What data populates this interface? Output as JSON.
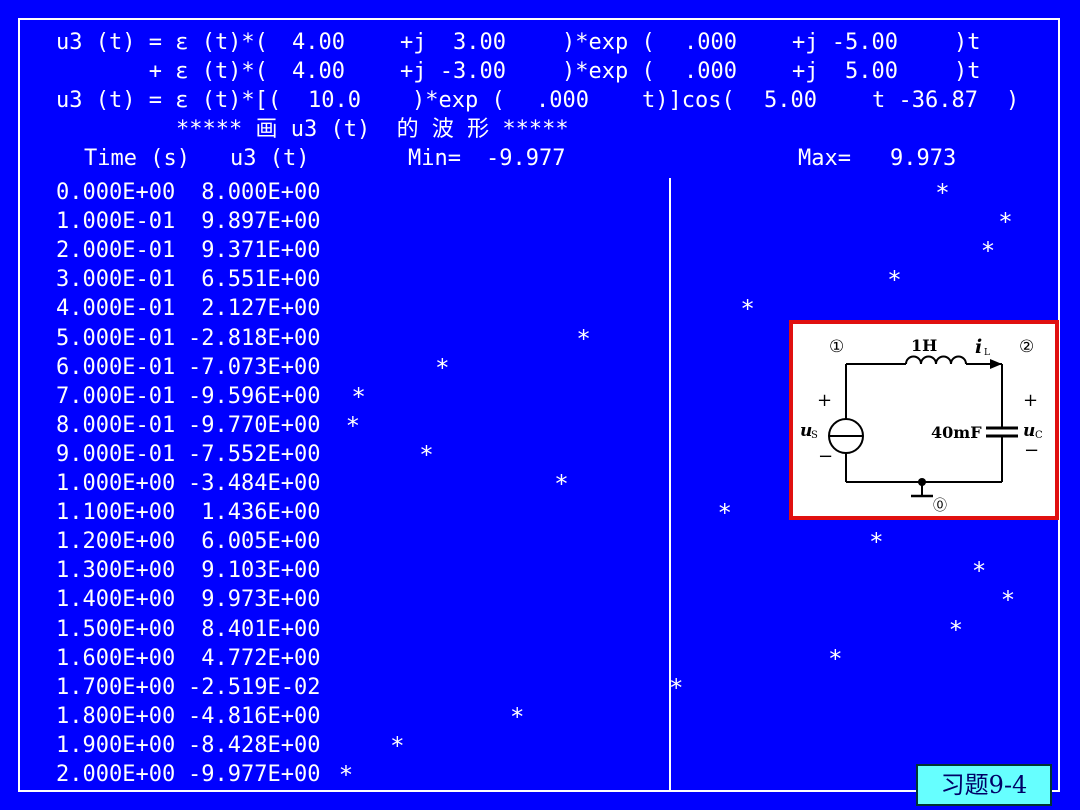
{
  "equations": [
    {
      "c0": "u3 (t) = ε (t)*(",
      "c1": "4.00",
      "c2": "+j  3.00",
      "c3": ")*exp (",
      "c4": ".000",
      "c5": "+j -5.00",
      "c6": ")t"
    },
    {
      "c0": "       + ε (t)*(",
      "c1": "4.00",
      "c2": "+j -3.00",
      "c3": ")*exp (",
      "c4": ".000",
      "c5": "+j  5.00",
      "c6": ")t"
    }
  ],
  "result": {
    "c0": "u3 (t) = ε (t)*[(",
    "c1": "10.0",
    "c2": ")*exp (",
    "c3": ".000",
    "c4": "t)]cos(",
    "c5": "5.00",
    "c6": "t -36.87",
    "c7": ")"
  },
  "waveform_title": "***** 画 u3 (t)  的 波 形 *****",
  "table_header": {
    "time": "Time (s)",
    "value": "u3 (t)",
    "min_label": "Min=",
    "min_value": "-9.977",
    "max_label": "Max=",
    "max_value": "9.973"
  },
  "plot_symbol": "*",
  "chart_data": {
    "type": "scatter",
    "x": [
      0.0,
      0.1,
      0.2,
      0.3,
      0.4,
      0.5,
      0.6,
      0.7,
      0.8,
      0.9,
      1.0,
      1.1,
      1.2,
      1.3,
      1.4,
      1.5,
      1.6,
      1.7,
      1.8,
      1.9,
      2.0
    ],
    "x_text": [
      "0.000E+00",
      "1.000E-01",
      "2.000E-01",
      "3.000E-01",
      "4.000E-01",
      "5.000E-01",
      "6.000E-01",
      "7.000E-01",
      "8.000E-01",
      "9.000E-01",
      "1.000E+00",
      "1.100E+00",
      "1.200E+00",
      "1.300E+00",
      "1.400E+00",
      "1.500E+00",
      "1.600E+00",
      "1.700E+00",
      "1.800E+00",
      "1.900E+00",
      "2.000E+00"
    ],
    "y": [
      8.0,
      9.897,
      9.371,
      6.551,
      2.127,
      -2.818,
      -7.073,
      -9.596,
      -9.77,
      -7.552,
      -3.484,
      1.436,
      6.005,
      9.103,
      9.973,
      8.401,
      4.772,
      -0.02519,
      -4.816,
      -8.428,
      -9.977
    ],
    "y_text": [
      " 8.000E+00",
      " 9.897E+00",
      " 9.371E+00",
      " 6.551E+00",
      " 2.127E+00",
      "-2.818E+00",
      "-7.073E+00",
      "-9.596E+00",
      "-9.770E+00",
      "-7.552E+00",
      "-3.484E+00",
      " 1.436E+00",
      " 6.005E+00",
      " 9.103E+00",
      " 9.973E+00",
      " 8.401E+00",
      " 4.772E+00",
      "-2.519E-02",
      "-4.816E+00",
      "-8.428E+00",
      "-9.977E+00"
    ],
    "xlabel": "Time (s)",
    "ylabel": "u3 (t)",
    "ylim": [
      -9.977,
      9.973
    ],
    "grid": false
  },
  "circuit": {
    "node1": "①",
    "node2": "②",
    "node0": "⓪",
    "inductor": "1H",
    "current": "i",
    "current_sub": "L",
    "source": "u",
    "source_sub": "S",
    "capacitor": "40mF",
    "cap_voltage": "u",
    "cap_voltage_sub": "C",
    "plus": "+",
    "minus": "−"
  },
  "exercise_label": "习题9-4",
  "colors": {
    "background": "#0000FF",
    "text": "#FFFFFF",
    "panel_border": "#E01010",
    "tag_background": "#66FFFF"
  }
}
